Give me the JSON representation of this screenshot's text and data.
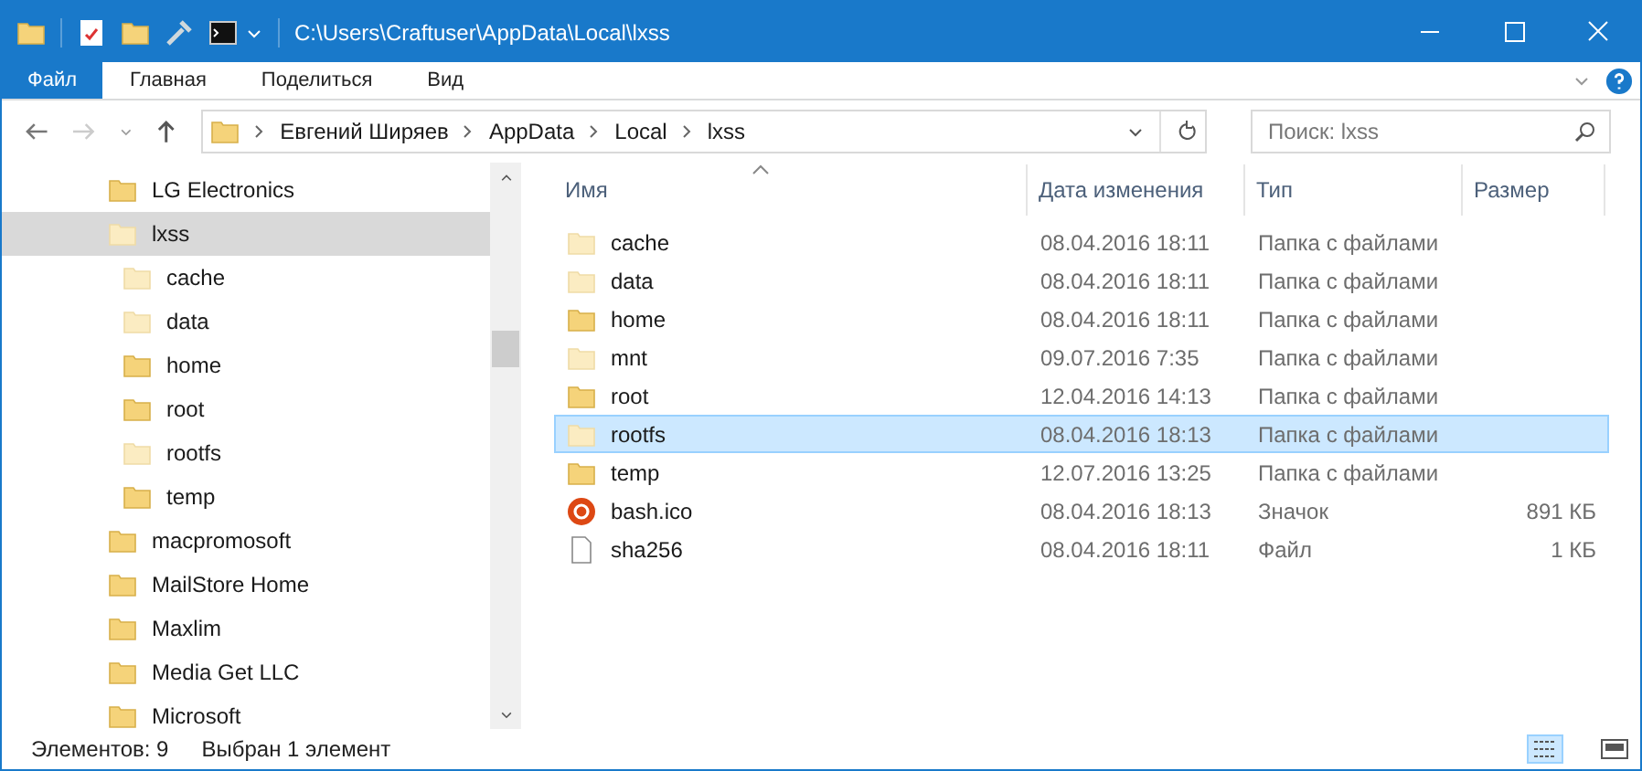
{
  "window": {
    "title": "C:\\Users\\Craftuser\\AppData\\Local\\lxss"
  },
  "ribbon_tabs": [
    {
      "label": "Файл",
      "selected": true
    },
    {
      "label": "Главная",
      "selected": false
    },
    {
      "label": "Поделиться",
      "selected": false
    },
    {
      "label": "Вид",
      "selected": false
    }
  ],
  "breadcrumb": [
    "Евгений Ширяев",
    "AppData",
    "Local",
    "lxss"
  ],
  "search": {
    "placeholder": "Поиск: lxss"
  },
  "sidebar": {
    "items": [
      {
        "label": "LG Electronics",
        "hidden": false,
        "selected": false
      },
      {
        "label": "lxss",
        "hidden": true,
        "selected": true,
        "children": [
          {
            "label": "cache",
            "hidden": true,
            "selected": false
          },
          {
            "label": "data",
            "hidden": true,
            "selected": false
          },
          {
            "label": "home",
            "hidden": false,
            "selected": false
          },
          {
            "label": "root",
            "hidden": false,
            "selected": false
          },
          {
            "label": "rootfs",
            "hidden": true,
            "selected": false
          },
          {
            "label": "temp",
            "hidden": false,
            "selected": false
          }
        ]
      },
      {
        "label": "macpromosoft",
        "hidden": false,
        "selected": false
      },
      {
        "label": "MailStore Home",
        "hidden": false,
        "selected": false
      },
      {
        "label": "Maxlim",
        "hidden": false,
        "selected": false
      },
      {
        "label": "Media Get LLC",
        "hidden": false,
        "selected": false
      },
      {
        "label": "Microsoft",
        "hidden": false,
        "selected": false
      }
    ]
  },
  "table": {
    "columns": [
      "Имя",
      "Дата изменения",
      "Тип",
      "Размер"
    ],
    "rows": [
      {
        "kind": "folder",
        "name": "cache",
        "hidden": true,
        "selected": false,
        "date": "08.04.2016 18:11",
        "type": "Папка с файлами"
      },
      {
        "kind": "folder",
        "name": "data",
        "hidden": true,
        "selected": false,
        "date": "08.04.2016 18:11",
        "type": "Папка с файлами"
      },
      {
        "kind": "folder",
        "name": "home",
        "hidden": false,
        "selected": false,
        "date": "08.04.2016 18:11",
        "type": "Папка с файлами"
      },
      {
        "kind": "folder",
        "name": "mnt",
        "hidden": true,
        "selected": false,
        "date": "09.07.2016 7:35",
        "type": "Папка с файлами"
      },
      {
        "kind": "folder",
        "name": "root",
        "hidden": false,
        "selected": false,
        "date": "12.04.2016 14:13",
        "type": "Папка с файлами"
      },
      {
        "kind": "folder",
        "name": "rootfs",
        "hidden": true,
        "selected": true,
        "date": "08.04.2016 18:13",
        "type": "Папка с файлами"
      },
      {
        "kind": "folder",
        "name": "temp",
        "hidden": false,
        "selected": false,
        "date": "12.07.2016 13:25",
        "type": "Папка с файлами"
      },
      {
        "kind": "ico",
        "name": "bash.ico",
        "selected": false,
        "date": "08.04.2016 18:13",
        "type": "Значок",
        "size": "891 КБ"
      },
      {
        "kind": "file",
        "name": "sha256",
        "selected": false,
        "date": "08.04.2016 18:11",
        "type": "Файл",
        "size": "1 КБ"
      }
    ]
  },
  "status_bar": {
    "item_count": "Элементов: 9",
    "selection": "Выбран 1 элемент"
  }
}
